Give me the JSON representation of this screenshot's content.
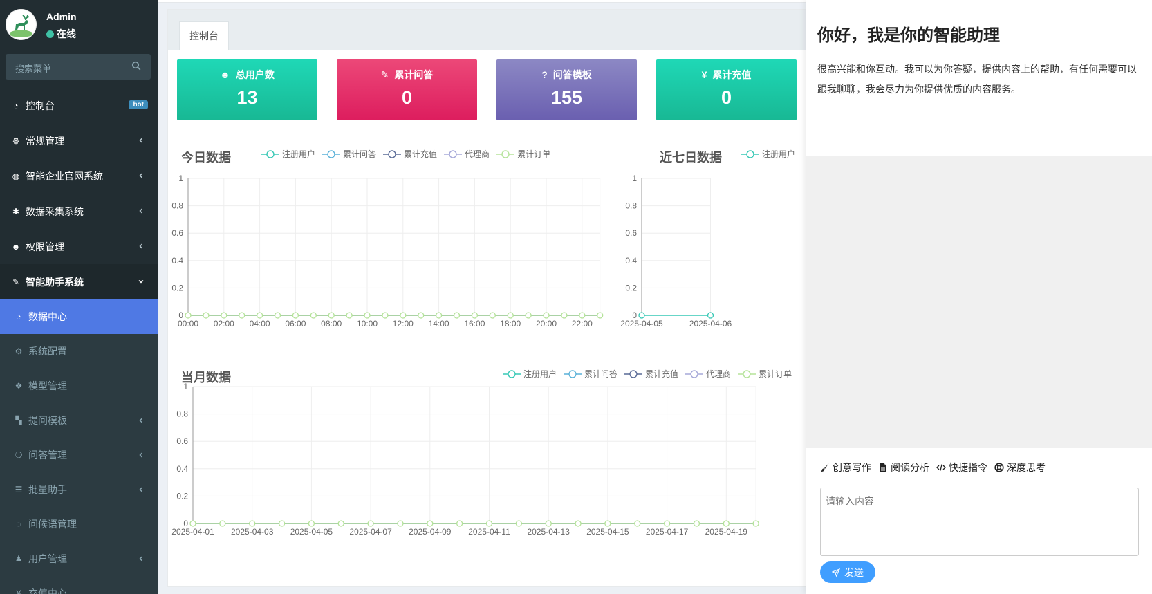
{
  "user": {
    "name": "Admin",
    "status": "在线"
  },
  "sidebar": {
    "search_placeholder": "搜索菜单",
    "items": [
      {
        "label": "控制台",
        "badge": "hot",
        "icon": "dashboard-icon"
      },
      {
        "label": "常规管理",
        "icon": "cogs-icon"
      },
      {
        "label": "智能企业官网系统",
        "icon": "globe-icon"
      },
      {
        "label": "数据采集系统",
        "icon": "bug-icon"
      },
      {
        "label": "权限管理",
        "icon": "group-icon"
      },
      {
        "label": "智能助手系统",
        "icon": "comments-icon"
      }
    ],
    "subitems": [
      {
        "label": "数据中心",
        "icon": "dashboard-icon"
      },
      {
        "label": "系统配置",
        "icon": "gear-icon"
      },
      {
        "label": "模型管理",
        "icon": "cubes-icon"
      },
      {
        "label": "提问模板",
        "icon": "template-icon"
      },
      {
        "label": "问答管理",
        "icon": "wechat-icon"
      },
      {
        "label": "批量助手",
        "icon": "list-icon"
      },
      {
        "label": "问候语管理",
        "icon": "comment-icon"
      },
      {
        "label": "用户管理",
        "icon": "user-icon"
      },
      {
        "label": "充值中心",
        "icon": "money-icon"
      }
    ]
  },
  "tabs": [
    {
      "label": "控制台"
    }
  ],
  "stats": [
    {
      "label": "总用户数",
      "value": "13",
      "icon": "users-icon",
      "color": "#1fcfae"
    },
    {
      "label": "累计问答",
      "value": "0",
      "icon": "comments-icon",
      "color": "#e5316b"
    },
    {
      "label": "问答模板",
      "value": "155",
      "icon": "question-icon",
      "color": "#7b73ba"
    },
    {
      "label": "累计充值",
      "value": "0",
      "icon": "yen-icon",
      "color": "#1fcfae"
    }
  ],
  "legend": [
    {
      "name": "注册用户",
      "color": "#37c8b5"
    },
    {
      "name": "累计问答",
      "color": "#5ab1d8"
    },
    {
      "name": "累计充值",
      "color": "#596a96"
    },
    {
      "name": "代理商",
      "color": "#a5a8d8"
    },
    {
      "name": "累计订单",
      "color": "#b5e39a"
    }
  ],
  "chart_data": [
    {
      "type": "line",
      "title": "今日数据",
      "x": [
        "00:00",
        "01:00",
        "02:00",
        "03:00",
        "04:00",
        "05:00",
        "06:00",
        "07:00",
        "08:00",
        "09:00",
        "10:00",
        "11:00",
        "12:00",
        "13:00",
        "14:00",
        "15:00",
        "16:00",
        "17:00",
        "18:00",
        "19:00",
        "20:00",
        "21:00",
        "22:00",
        "23:00"
      ],
      "x_tick_labels": [
        "00:00",
        "02:00",
        "04:00",
        "06:00",
        "08:00",
        "10:00",
        "12:00",
        "14:00",
        "16:00",
        "18:00",
        "20:00",
        "22:00"
      ],
      "ylim": [
        0,
        1
      ],
      "y_ticks": [
        "0",
        "0.2",
        "0.4",
        "0.6",
        "0.8",
        "1"
      ],
      "series": [
        {
          "name": "注册用户",
          "values": [
            0,
            0,
            0,
            0,
            0,
            0,
            0,
            0,
            0,
            0,
            0,
            0,
            0,
            0,
            0,
            0,
            0,
            0,
            0,
            0,
            0,
            0,
            0,
            0
          ]
        },
        {
          "name": "累计问答",
          "values": [
            0,
            0,
            0,
            0,
            0,
            0,
            0,
            0,
            0,
            0,
            0,
            0,
            0,
            0,
            0,
            0,
            0,
            0,
            0,
            0,
            0,
            0,
            0,
            0
          ]
        },
        {
          "name": "累计充值",
          "values": [
            0,
            0,
            0,
            0,
            0,
            0,
            0,
            0,
            0,
            0,
            0,
            0,
            0,
            0,
            0,
            0,
            0,
            0,
            0,
            0,
            0,
            0,
            0,
            0
          ]
        },
        {
          "name": "代理商",
          "values": [
            0,
            0,
            0,
            0,
            0,
            0,
            0,
            0,
            0,
            0,
            0,
            0,
            0,
            0,
            0,
            0,
            0,
            0,
            0,
            0,
            0,
            0,
            0,
            0
          ]
        },
        {
          "name": "累计订单",
          "values": [
            0,
            0,
            0,
            0,
            0,
            0,
            0,
            0,
            0,
            0,
            0,
            0,
            0,
            0,
            0,
            0,
            0,
            0,
            0,
            0,
            0,
            0,
            0,
            0
          ]
        }
      ]
    },
    {
      "type": "line",
      "title": "近七日数据",
      "x": [
        "2025-04-05",
        "2025-04-06"
      ],
      "x_tick_labels": [
        "2025-04-05",
        "2025-04-06"
      ],
      "ylim": [
        0,
        1
      ],
      "y_ticks": [
        "0",
        "0.2",
        "0.4",
        "0.6",
        "0.8",
        "1"
      ],
      "series": [
        {
          "name": "注册用户",
          "values": [
            0,
            0
          ]
        }
      ]
    },
    {
      "type": "line",
      "title": "当月数据",
      "x": [
        "2025-04-01",
        "2025-04-02",
        "2025-04-03",
        "2025-04-04",
        "2025-04-05",
        "2025-04-06",
        "2025-04-07",
        "2025-04-08",
        "2025-04-09",
        "2025-04-10",
        "2025-04-11",
        "2025-04-12",
        "2025-04-13",
        "2025-04-14",
        "2025-04-15",
        "2025-04-16",
        "2025-04-17",
        "2025-04-18",
        "2025-04-19",
        "2025-04-20"
      ],
      "x_tick_labels": [
        "2025-04-01",
        "2025-04-03",
        "2025-04-05",
        "2025-04-07",
        "2025-04-09",
        "2025-04-11",
        "2025-04-13",
        "2025-04-15",
        "2025-04-17",
        "2025-04-19"
      ],
      "ylim": [
        0,
        1
      ],
      "y_ticks": [
        "0",
        "0.2",
        "0.4",
        "0.6",
        "0.8",
        "1"
      ],
      "series": [
        {
          "name": "注册用户",
          "values": [
            0,
            0,
            0,
            0,
            0,
            0,
            0,
            0,
            0,
            0,
            0,
            0,
            0,
            0,
            0,
            0,
            0,
            0,
            0,
            0
          ]
        },
        {
          "name": "累计问答",
          "values": [
            0,
            0,
            0,
            0,
            0,
            0,
            0,
            0,
            0,
            0,
            0,
            0,
            0,
            0,
            0,
            0,
            0,
            0,
            0,
            0
          ]
        },
        {
          "name": "累计充值",
          "values": [
            0,
            0,
            0,
            0,
            0,
            0,
            0,
            0,
            0,
            0,
            0,
            0,
            0,
            0,
            0,
            0,
            0,
            0,
            0,
            0
          ]
        },
        {
          "name": "代理商",
          "values": [
            0,
            0,
            0,
            0,
            0,
            0,
            0,
            0,
            0,
            0,
            0,
            0,
            0,
            0,
            0,
            0,
            0,
            0,
            0,
            0
          ]
        },
        {
          "name": "累计订单",
          "values": [
            0,
            0,
            0,
            0,
            0,
            0,
            0,
            0,
            0,
            0,
            0,
            0,
            0,
            0,
            0,
            0,
            0,
            0,
            0,
            0
          ]
        }
      ]
    }
  ],
  "assistant": {
    "title": "你好，我是你的智能助理",
    "intro": "很高兴能和你互动。我可以为你答疑，提供内容上的帮助，有任何需要可以跟我聊聊，我会尽力为你提供优质的内容服务。",
    "actions": [
      {
        "label": "创意写作",
        "icon": "brush-icon"
      },
      {
        "label": "阅读分析",
        "icon": "file-icon"
      },
      {
        "label": "快捷指令",
        "icon": "code-icon"
      },
      {
        "label": "深度思考",
        "icon": "lifebuoy-icon"
      }
    ],
    "input_placeholder": "请输入内容",
    "send_label": "发送"
  }
}
